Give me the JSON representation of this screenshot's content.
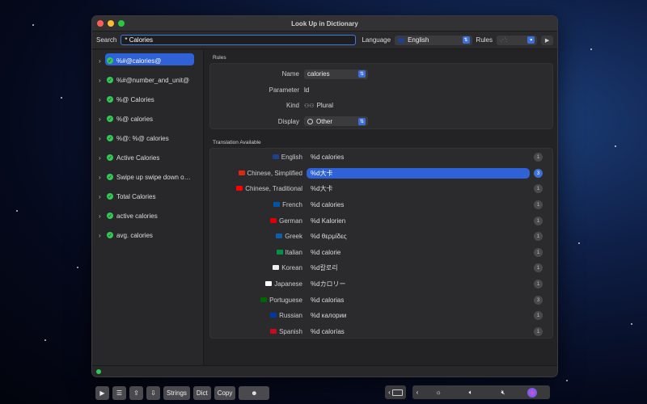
{
  "window": {
    "title": "Look Up in Dictionary"
  },
  "toolbar": {
    "search_label": "Search",
    "search_value": "* Calories",
    "language_label": "Language",
    "language_value": "English",
    "rules_label": "Rules",
    "rules_value": "𑀀 𑀁 𑀂"
  },
  "sidebar": {
    "items": [
      {
        "label": "%#@calories@",
        "selected": true
      },
      {
        "label": "%#@number_and_unit@"
      },
      {
        "label": "%@ Calories"
      },
      {
        "label": "%@ calories"
      },
      {
        "label": "%@: %@ calories"
      },
      {
        "label": "Active Calories"
      },
      {
        "label": "Swipe up swipe down or..."
      },
      {
        "label": "Total Calories"
      },
      {
        "label": "active calories"
      },
      {
        "label": "avg. calories"
      }
    ]
  },
  "rules": {
    "section_title": "Rules",
    "name_key": "Name",
    "name_value": "calories",
    "parameter_key": "Parameter",
    "parameter_value": "ld",
    "kind_key": "Kind",
    "kind_value": "Plural",
    "display_key": "Display",
    "display_value": "Other"
  },
  "translations": {
    "section_title": "Translation Available",
    "rows": [
      {
        "lang": "English",
        "value": "%d calories",
        "count": "1",
        "flag": "#1f3f8f"
      },
      {
        "lang": "Chinese, Simplified",
        "value": "%d大卡",
        "count": "3",
        "flag": "#de2910",
        "selected": true
      },
      {
        "lang": "Chinese, Traditional",
        "value": "%d大卡",
        "count": "1",
        "flag": "#fe0000"
      },
      {
        "lang": "French",
        "value": "%d calories",
        "count": "1",
        "flag": "#0055a4"
      },
      {
        "lang": "German",
        "value": "%d Kalorien",
        "count": "1",
        "flag": "#dd0000"
      },
      {
        "lang": "Greek",
        "value": "%d θερμίδες",
        "count": "1",
        "flag": "#0d5eaf"
      },
      {
        "lang": "Italian",
        "value": "%d calorie",
        "count": "1",
        "flag": "#009246"
      },
      {
        "lang": "Korean",
        "value": "%d칼로리",
        "count": "1",
        "flag": "#eeeeee"
      },
      {
        "lang": "Japanese",
        "value": "%dカロリー",
        "count": "1",
        "flag": "#ffffff"
      },
      {
        "lang": "Portuguese",
        "value": "%d calorias",
        "count": "3",
        "flag": "#006600"
      },
      {
        "lang": "Russian",
        "value": "%d калории",
        "count": "1",
        "flag": "#0039a6"
      },
      {
        "lang": "Spanish",
        "value": "%d calorías",
        "count": "1",
        "flag": "#c60b1e"
      }
    ]
  },
  "touchbar": {
    "strings_label": "Strings",
    "dict_label": "Dict",
    "copy_label": "Copy",
    "emoji": "☻"
  }
}
